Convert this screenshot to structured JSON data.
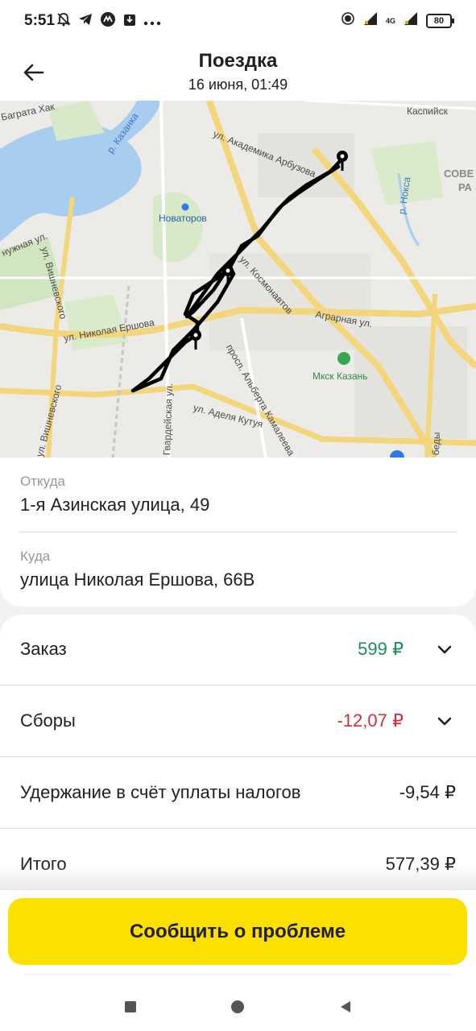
{
  "status_bar": {
    "time": "5:51",
    "left_icons": [
      "alarm-off-icon",
      "telegram-icon",
      "app-icon",
      "download-icon",
      "more-icon"
    ],
    "network": "4G",
    "battery": "80"
  },
  "header": {
    "title": "Поездка",
    "subtitle": "16 июня, 01:49"
  },
  "map": {
    "labels": {
      "arbuzova": "ул. Академика Арбузова",
      "novatorov": "Новаторов",
      "vishnevskogo": "ул. Вишневского",
      "ershova": "ул. Николая Ершова",
      "kosmonavtov": "ул. Космонавтов",
      "agrarnaya": "Аграрная ул.",
      "kamaleeva": "просп. Альберта Камалеева",
      "kutuya": "ул. Аделя Кутуя",
      "gvardeiskaya": "Гвардейская ул.",
      "mcsk": "Мкск Казань",
      "nokса": "р. Нокса",
      "kazanka": "р. Казанка",
      "kaspiyskaya": "Каспийск",
      "sove": "СОВЕ",
      "ra": "РА",
      "bagrata": "Баграта Хак",
      "nuzhnaya": "нужная ул.",
      "vishnevskogo2": "ул. Вишневского",
      "bedy": "беды"
    },
    "route_color": "#000000"
  },
  "trip": {
    "from_label": "Откуда",
    "from_value": "1-я Азинская улица, 49",
    "to_label": "Куда",
    "to_value": "улица Николая Ершова, 66В"
  },
  "price": {
    "order_label": "Заказ",
    "order_value": "599 ₽",
    "order_color": "#1c8c55",
    "fees_label": "Сборы",
    "fees_value": "-12,07 ₽",
    "fees_color": "#c8313e",
    "tax_label": "Удержание в счёт уплаты налогов",
    "tax_value": "-9,54 ₽",
    "total_label": "Итого",
    "total_value": "577,39 ₽"
  },
  "actions": {
    "report_label": "Сообщить о проблеме",
    "accent": "#fce000"
  }
}
